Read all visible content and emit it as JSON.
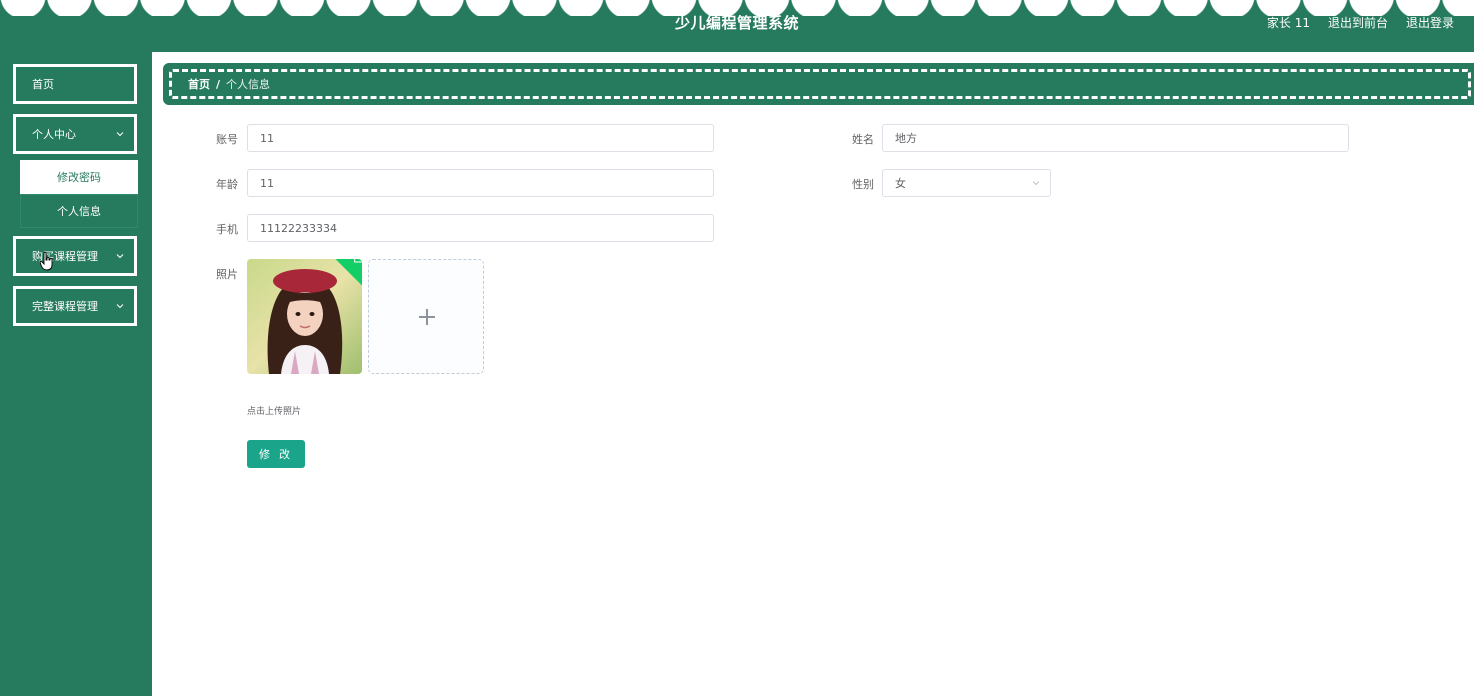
{
  "header": {
    "title": "少儿编程管理系统",
    "user": "家长 11",
    "front_link": "退出到前台",
    "logout_link": "退出登录"
  },
  "sidebar": {
    "home": "首页",
    "personal_center": "个人中心",
    "change_password": "修改密码",
    "personal_info": "个人信息",
    "purchased_course_mgmt": "购买课程管理",
    "complete_course_mgmt": "完整课程管理"
  },
  "breadcrumb": {
    "home": "首页",
    "separator": "/",
    "current": "个人信息"
  },
  "form": {
    "account_label": "账号",
    "account_value": "11",
    "name_label": "姓名",
    "name_value": "地方",
    "age_label": "年龄",
    "age_value": "11",
    "gender_label": "性别",
    "gender_value": "女",
    "phone_label": "手机",
    "phone_value": "11122233334",
    "photo_label": "照片",
    "upload_tip": "点击上传照片",
    "submit_label": "修 改"
  },
  "colors": {
    "primary": "#267a5e",
    "button": "#1aa58a",
    "success": "#13ce66"
  }
}
